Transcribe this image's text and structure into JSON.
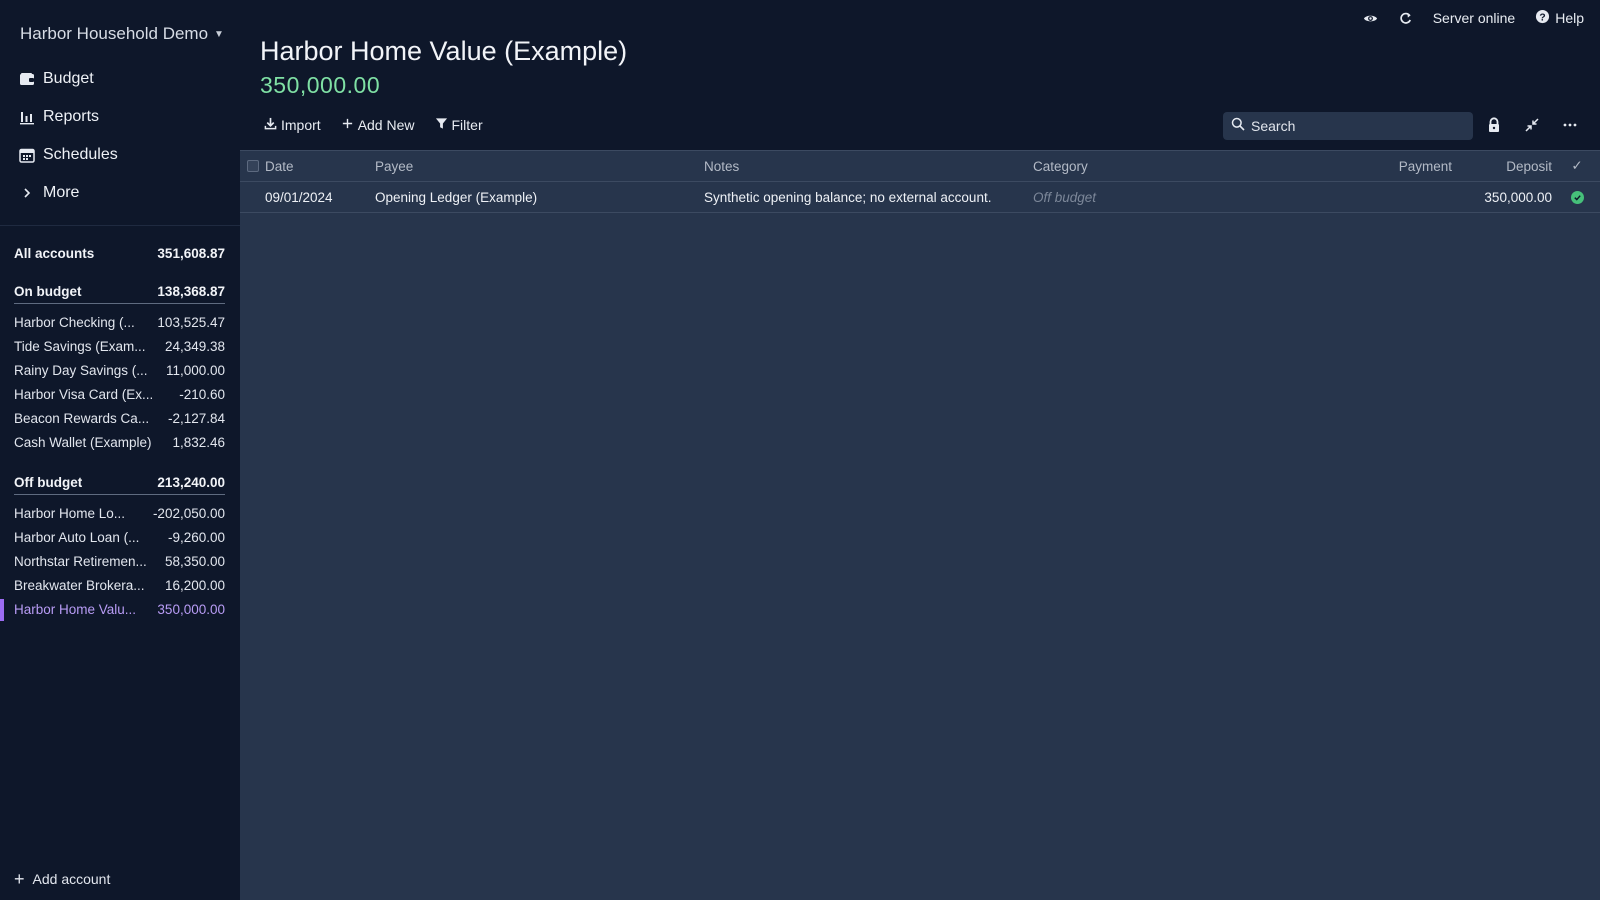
{
  "sidebar": {
    "budget_name": "Harbor Household Demo",
    "nav": [
      {
        "label": "Budget",
        "icon": "wallet-icon"
      },
      {
        "label": "Reports",
        "icon": "bar-chart-icon"
      },
      {
        "label": "Schedules",
        "icon": "calendar-icon"
      },
      {
        "label": "More",
        "icon": "chevron-right-icon"
      }
    ],
    "all_accounts": {
      "label": "All accounts",
      "balance": "351,608.87"
    },
    "on_budget": {
      "label": "On budget",
      "balance": "138,368.87",
      "accounts": [
        {
          "name": "Harbor Checking (...",
          "balance": "103,525.47"
        },
        {
          "name": "Tide Savings (Exam...",
          "balance": "24,349.38"
        },
        {
          "name": "Rainy Day Savings (...",
          "balance": "11,000.00"
        },
        {
          "name": "Harbor Visa Card (Ex...",
          "balance": "-210.60"
        },
        {
          "name": "Beacon Rewards Ca...",
          "balance": "-2,127.84"
        },
        {
          "name": "Cash Wallet (Example)",
          "balance": "1,832.46"
        }
      ]
    },
    "off_budget": {
      "label": "Off budget",
      "balance": "213,240.00",
      "accounts": [
        {
          "name": "Harbor Home Lo...",
          "balance": "-202,050.00"
        },
        {
          "name": "Harbor Auto Loan (...",
          "balance": "-9,260.00"
        },
        {
          "name": "Northstar Retiremen...",
          "balance": "58,350.00"
        },
        {
          "name": "Breakwater Brokera...",
          "balance": "16,200.00"
        },
        {
          "name": "Harbor Home Valu...",
          "balance": "350,000.00"
        }
      ]
    },
    "add_account": "Add account"
  },
  "header": {
    "server_status": "Server online",
    "help": "Help",
    "account_title": "Harbor Home Value (Example)",
    "account_balance": "350,000.00"
  },
  "toolbar": {
    "import": "Import",
    "add_new": "Add New",
    "filter": "Filter",
    "search_placeholder": "Search"
  },
  "table": {
    "columns": {
      "date": "Date",
      "payee": "Payee",
      "notes": "Notes",
      "category": "Category",
      "payment": "Payment",
      "deposit": "Deposit",
      "cleared": "✓"
    },
    "rows": [
      {
        "date": "09/01/2024",
        "payee": "Opening Ledger (Example)",
        "notes": "Synthetic opening balance; no external account.",
        "category": "Off budget",
        "payment": "",
        "deposit": "350,000.00",
        "cleared": true
      }
    ]
  },
  "colors": {
    "accent": "#9b6cf2",
    "positive": "#7fe0a4",
    "cleared": "#46c07a",
    "sidebar_bg": "#0e172a",
    "content_bg": "#27354c"
  }
}
